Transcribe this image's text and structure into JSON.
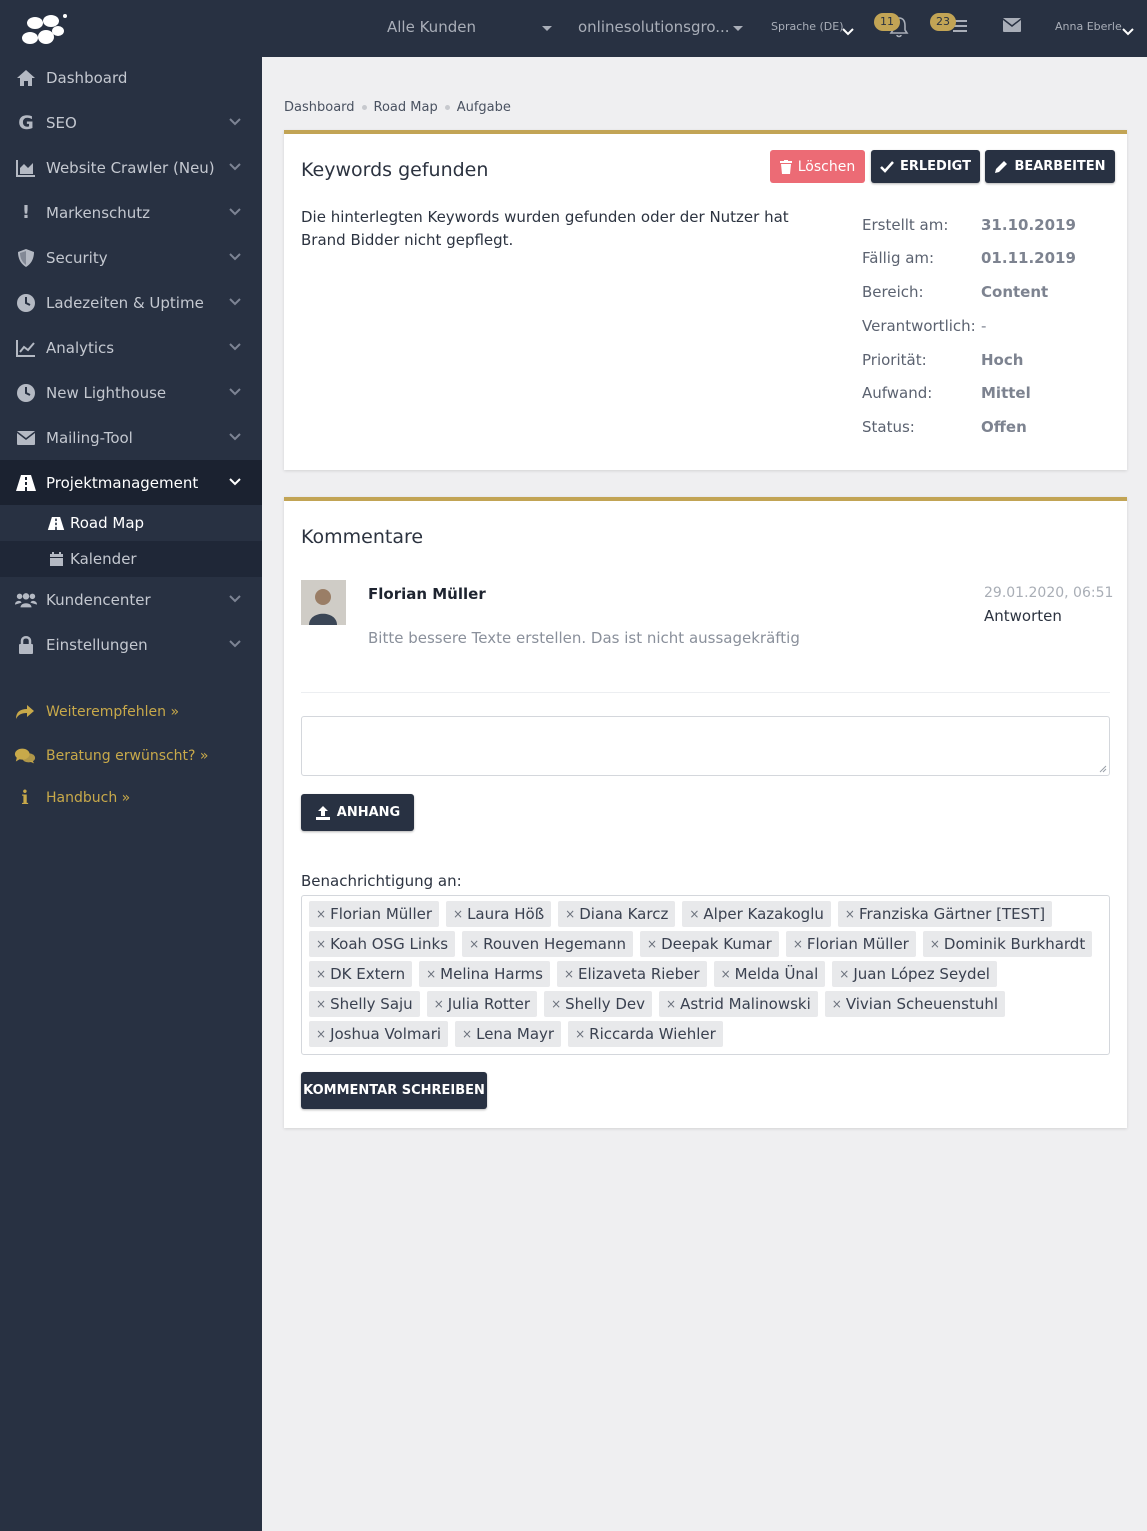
{
  "topbar": {
    "customer_filter": "Alle Kunden",
    "project_filter": "onlinesolutionsgro...",
    "language": "Sprache (DE)",
    "notifications_count": "11",
    "tasks_count": "23",
    "user_name": "Anna Eberle"
  },
  "sidebar": {
    "items": [
      {
        "label": "Dashboard",
        "icon": "home-icon"
      },
      {
        "label": "SEO",
        "icon": "google-icon"
      },
      {
        "label": "Website Crawler (Neu)",
        "icon": "chart-area-icon"
      },
      {
        "label": "Markenschutz",
        "icon": "exclamation-icon"
      },
      {
        "label": "Security",
        "icon": "shield-icon"
      },
      {
        "label": "Ladezeiten & Uptime",
        "icon": "clock-icon"
      },
      {
        "label": "Analytics",
        "icon": "line-chart-icon"
      },
      {
        "label": "New Lighthouse",
        "icon": "clock-icon"
      },
      {
        "label": "Mailing-Tool",
        "icon": "envelope-icon"
      },
      {
        "label": "Projektmanagement",
        "icon": "road-icon"
      }
    ],
    "sub_items": [
      {
        "label": "Road Map",
        "icon": "road-icon"
      },
      {
        "label": "Kalender",
        "icon": "calendar-icon"
      }
    ],
    "items_after": [
      {
        "label": "Kundencenter",
        "icon": "users-icon"
      },
      {
        "label": "Einstellungen",
        "icon": "lock-icon"
      }
    ],
    "extras": [
      {
        "label": "Weiterempfehlen »",
        "icon": "share-icon"
      },
      {
        "label": "Beratung erwünscht? »",
        "icon": "comments-icon"
      },
      {
        "label": "Handbuch »",
        "icon": "info-icon"
      }
    ]
  },
  "breadcrumb": [
    "Dashboard",
    "Road Map",
    "Aufgabe"
  ],
  "task": {
    "title": "Keywords gefunden",
    "delete_label": "Löschen",
    "done_label": "ERLEDIGT",
    "edit_label": "BEARBEITEN",
    "description": "Die hinterlegten Keywords wurden gefunden oder der Nutzer hat Brand Bidder nicht gepflegt.",
    "meta": [
      {
        "label": "Erstellt am:",
        "value": "31.10.2019"
      },
      {
        "label": "Fällig am:",
        "value": "01.11.2019"
      },
      {
        "label": "Bereich:",
        "value": "Content"
      },
      {
        "label": "Verantwortlich:",
        "value": "-"
      },
      {
        "label": "Priorität:",
        "value": "Hoch"
      },
      {
        "label": "Aufwand:",
        "value": "Mittel"
      },
      {
        "label": "Status:",
        "value": "Offen"
      }
    ]
  },
  "comments": {
    "title": "Kommentare",
    "entry": {
      "author": "Florian Müller",
      "date": "29.01.2020, 06:51",
      "reply_label": "Antworten",
      "text": "Bitte bessere Texte erstellen. Das ist nicht aussagekräftig"
    },
    "attach_label": "ANHANG",
    "notify_label": "Benachrichtigung an:",
    "recipients": [
      "Florian Müller",
      "Laura Höß",
      "Diana Karcz",
      "Alper Kazakoglu",
      "Franziska Gärtner [TEST]",
      "Koah OSG Links",
      "Rouven Hegemann",
      "Deepak Kumar",
      "Florian Müller",
      "Dominik Burkhardt",
      "DK Extern",
      "Melina Harms",
      "Elizaveta Rieber",
      "Melda Ünal",
      "Juan López Seydel",
      "Shelly Saju",
      "Julia Rotter",
      "Shelly Dev",
      "Astrid Malinowski",
      "Vivian Scheuenstuhl",
      "Joshua Volmari",
      "Lena Mayr",
      "Riccarda Wiehler"
    ],
    "remove_symbol": "×",
    "submit_label": "KOMMENTAR SCHREIBEN"
  },
  "colors": {
    "sidebar_bg": "#283142",
    "accent_gold": "#c2a455",
    "delete_red": "#ec6b75",
    "page_bg": "#efeff1"
  }
}
